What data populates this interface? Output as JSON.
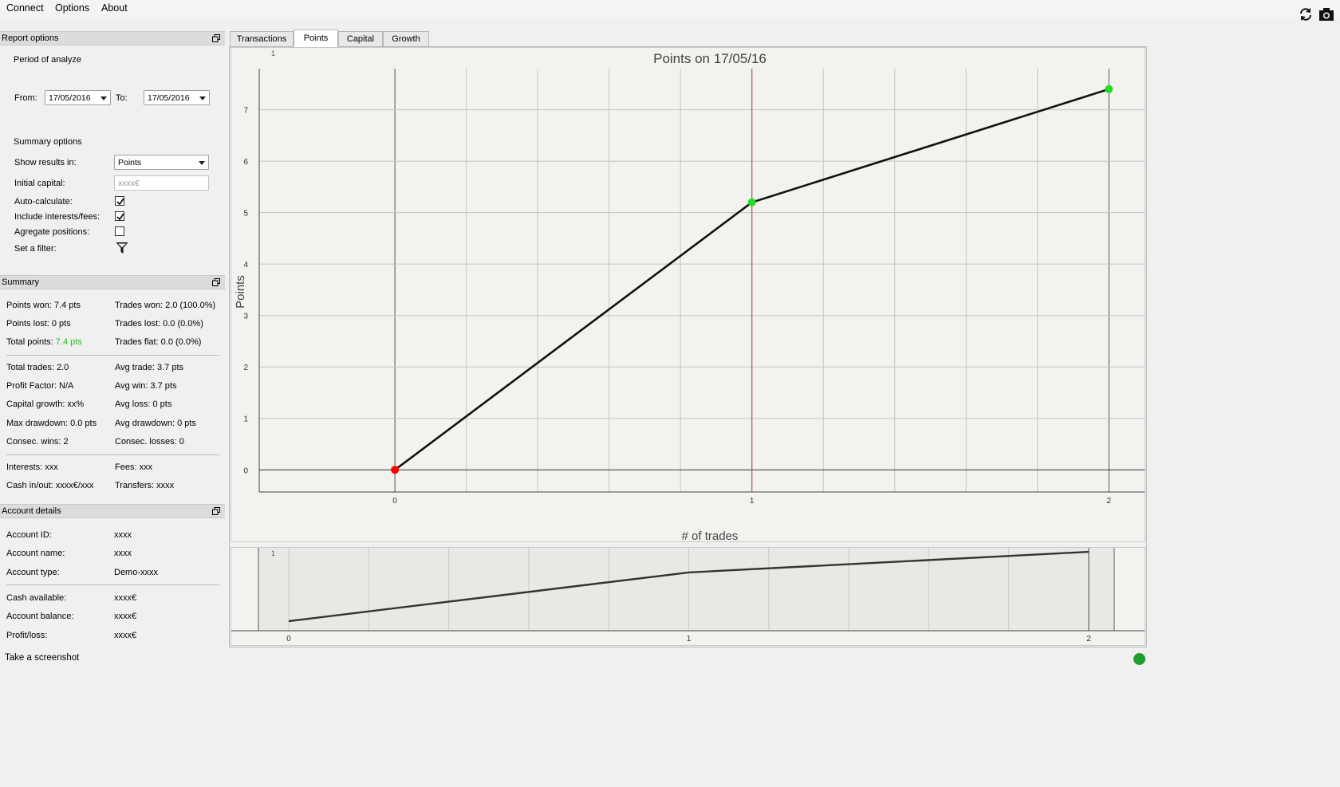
{
  "menu": {
    "items": [
      "Connect",
      "Options",
      "About"
    ]
  },
  "toolbar_icons": [
    "refresh-icon",
    "camera-icon"
  ],
  "report_options": {
    "title": "Report options",
    "period_label": "Period of analyze",
    "from_label": "From:",
    "from_value": "17/05/2016",
    "to_label": "To:",
    "to_value": "17/05/2016",
    "summary_options_label": "Summary options",
    "show_results_label": "Show results in:",
    "show_results_value": "Points",
    "initial_capital_label": "Initial capital:",
    "initial_capital_placeholder": "xxxx€",
    "auto_calculate_label": "Auto-calculate:",
    "auto_calculate_checked": true,
    "include_interests_label": "Include interests/fees:",
    "include_interests_checked": true,
    "aggregate_label": "Agregate positions:",
    "aggregate_checked": false,
    "filter_label": "Set a filter:"
  },
  "summary": {
    "title": "Summary",
    "points_won": "Points won: 7.4 pts",
    "trades_won": "Trades won: 2.0 (100.0%)",
    "points_lost": "Points lost: 0 pts",
    "trades_lost": "Trades lost: 0.0 (0.0%)",
    "total_points_label": "Total points: ",
    "total_points_value": "7.4 pts",
    "total_points_color": "#2db52d",
    "trades_flat": "Trades flat: 0.0 (0.0%)",
    "total_trades": "Total trades: 2.0",
    "avg_trade": "Avg trade: 3.7 pts",
    "profit_factor": "Profit Factor: N/A",
    "avg_win": "Avg win: 3.7 pts",
    "capital_growth": "Capital growth: xx%",
    "avg_loss": "Avg loss: 0 pts",
    "max_drawdown": "Max drawdown: 0.0 pts",
    "avg_drawdown": "Avg drawdown: 0 pts",
    "consec_wins": "Consec. wins: 2",
    "consec_losses": "Consec. losses: 0",
    "interests": "Interests: xxx",
    "fees": "Fees: xxx",
    "cash_inout": "Cash in/out: xxxx€/xxx",
    "transfers": "Transfers: xxxx"
  },
  "account": {
    "title": "Account details",
    "id_label": "Account ID:",
    "id_value": "xxxx",
    "name_label": "Account name:",
    "name_value": "xxxx",
    "type_label": "Account type:",
    "type_value": "Demo-xxxx",
    "cash_label": "Cash available:",
    "cash_value": "xxxx€",
    "balance_label": "Account balance:",
    "balance_value": "xxxx€",
    "pl_label": "Profit/loss:",
    "pl_value": "xxxx€"
  },
  "tabs": [
    "Transactions",
    "Points",
    "Capital",
    "Growth"
  ],
  "active_tab": "Points",
  "status": {
    "text": "Take a screenshot",
    "indicator_color": "#1f9e2c"
  },
  "chart_data": {
    "type": "line",
    "title": "Points on 17/05/16",
    "xlabel": "# of trades",
    "ylabel": "Points",
    "x": [
      0,
      1,
      2
    ],
    "series": [
      {
        "values": [
          0,
          5.2,
          7.4
        ]
      }
    ],
    "point_colors": [
      "#ff0000",
      "#22dd22",
      "#22dd22"
    ],
    "x_ticks": [
      "0",
      "1",
      "2"
    ],
    "y_ticks": [
      "0",
      "1",
      "2",
      "3",
      "4",
      "5",
      "6",
      "7"
    ],
    "corner_label": "1",
    "xlim": [
      -0.38,
      2.1
    ],
    "ylim": [
      -0.43,
      7.8
    ],
    "grid": true,
    "cursor_x": 1,
    "cursor_color": "#c0606a",
    "overview": {
      "x_ticks": [
        "0",
        "1",
        "2"
      ],
      "corner_label": "1",
      "values": [
        0,
        5.2,
        7.4
      ]
    }
  }
}
